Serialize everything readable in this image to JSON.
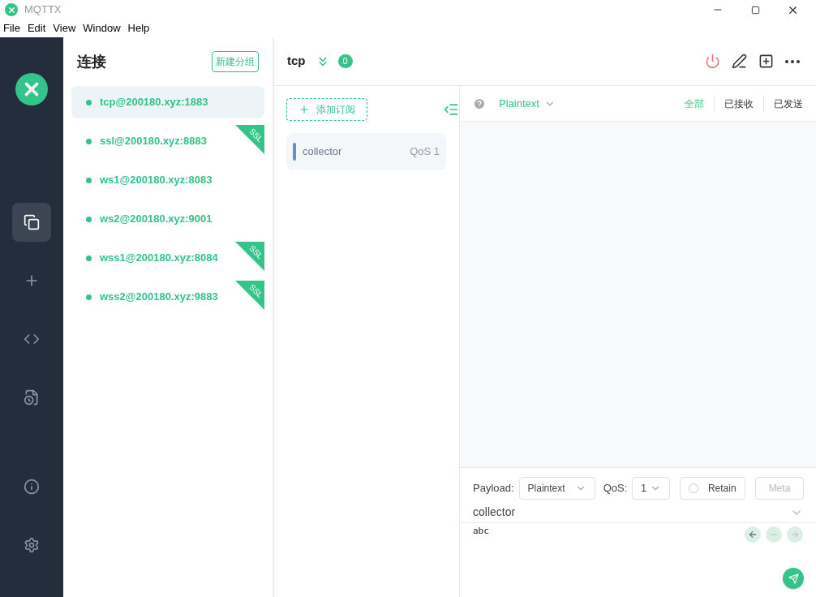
{
  "window": {
    "title": "MQTTX"
  },
  "menu": [
    "File",
    "Edit",
    "View",
    "Window",
    "Help"
  ],
  "nav": [
    {
      "kind": "connections",
      "selected": true
    },
    {
      "kind": "new",
      "selected": false
    },
    {
      "kind": "script",
      "selected": false
    },
    {
      "kind": "log",
      "selected": false
    },
    {
      "kind": "about",
      "selected": false
    },
    {
      "kind": "settings",
      "selected": false
    }
  ],
  "connections_panel": {
    "title": "连接",
    "new_group_button": "新建分组",
    "items": [
      {
        "name": "tcp@200180.xyz:1883",
        "selected": true,
        "connected": true
      },
      {
        "name": "ssl@200180.xyz:8883",
        "selected": false,
        "connected": true,
        "badge": "SSL"
      },
      {
        "name": "ws1@200180.xyz:8083",
        "selected": false,
        "connected": true
      },
      {
        "name": "ws2@200180.xyz:9001",
        "selected": false,
        "connected": true
      },
      {
        "name": "wss1@200180.xyz:8084",
        "selected": false,
        "connected": true,
        "badge": "SSL"
      },
      {
        "name": "wss2@200180.xyz:9883",
        "selected": false,
        "connected": true,
        "badge": "SSL"
      }
    ]
  },
  "header": {
    "title": "tcp",
    "unread": "0"
  },
  "subscriptions": {
    "add_button": "添加订阅",
    "items": [
      {
        "topic": "collector",
        "qos": "QoS 1",
        "color": "#6a8fc7"
      }
    ]
  },
  "messages": {
    "format": "Plaintext",
    "filters": [
      {
        "label": "全部",
        "selected": true
      },
      {
        "label": "已接收",
        "selected": false
      },
      {
        "label": "已发送",
        "selected": false
      }
    ]
  },
  "composer": {
    "payload_label": "Payload:",
    "payload_format": "Plaintext",
    "qos_label": "QoS:",
    "qos": "1",
    "retain": {
      "label": "Retain",
      "checked": false
    },
    "meta_button": "Meta",
    "topic": "collector",
    "payload": "abc"
  }
}
